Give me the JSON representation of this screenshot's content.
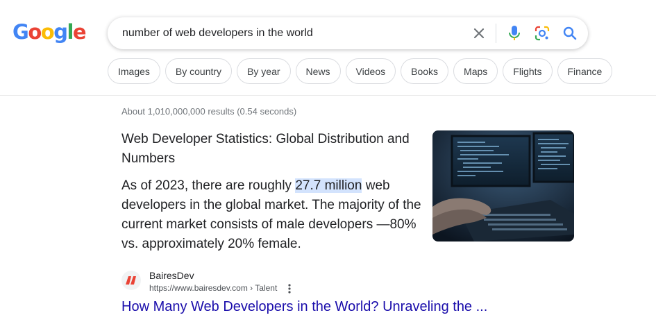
{
  "logo": {
    "text": "Google"
  },
  "search": {
    "query": "number of web developers in the world"
  },
  "chips": [
    "Images",
    "By country",
    "By year",
    "News",
    "Videos",
    "Books",
    "Maps",
    "Flights",
    "Finance"
  ],
  "result_stats": "About 1,010,000,000 results (0.54 seconds)",
  "snippet": {
    "title": "Web Developer Statistics: Global Distribution and Numbers",
    "text_before": "As of 2023, there are roughly ",
    "text_highlight": "27.7 million",
    "text_after": " web developers in the global market. The majority of the current market consists of male developers —80% vs. approximately 20% female."
  },
  "source": {
    "name": "BairesDev",
    "url": "https://www.bairesdev.com › Talent",
    "link_title": "How Many Web Developers in the World? Unraveling the ..."
  },
  "icons": {
    "clear": "close-icon",
    "voice": "mic-icon",
    "lens": "camera-lens-icon",
    "search": "search-icon",
    "more": "kebab-menu-icon"
  },
  "colors": {
    "link": "#1a0dab",
    "highlight": "#d3e3fd",
    "google_blue": "#4285f4",
    "google_red": "#ea4335",
    "google_yellow": "#fbbc05",
    "google_green": "#34a853",
    "favicon": "#ea4335"
  }
}
